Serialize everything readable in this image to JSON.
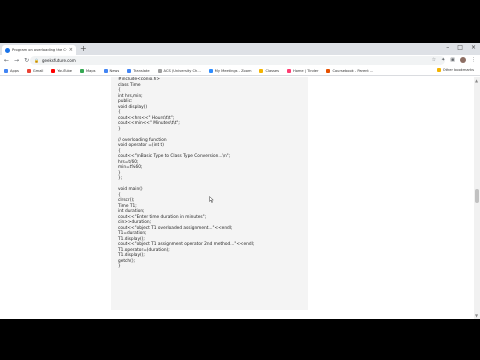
{
  "tab": {
    "title": "Program on overloading the C++",
    "close": "×",
    "new": "+"
  },
  "window": {
    "minimize": "–",
    "maximize": "□",
    "close": "×"
  },
  "toolbar": {
    "url": "geeksfuture.com",
    "back": "←",
    "forward": "→",
    "reload": "↻",
    "lock": "🔒"
  },
  "bookmarks": {
    "items": [
      {
        "label": "Apps",
        "color": "#4285f4"
      },
      {
        "label": "Gmail",
        "color": "#ea4335"
      },
      {
        "label": "YouTube",
        "color": "#ff0000"
      },
      {
        "label": "Maps",
        "color": "#34a853"
      },
      {
        "label": "News",
        "color": "#4285f4"
      },
      {
        "label": "Translate",
        "color": "#4285f4"
      },
      {
        "label": "ACS (University Ch...",
        "color": "#9e9e9e"
      },
      {
        "label": "My Meetings - Zoom",
        "color": "#2d8cff"
      },
      {
        "label": "Classes",
        "color": "#f4b400"
      },
      {
        "label": "Home | Tinder",
        "color": "#fe3c72"
      },
      {
        "label": "Coursebook - Parent ...",
        "color": "#e65100"
      }
    ],
    "other": "Other bookmarks"
  },
  "code": {
    "lines": [
      "#include<conio.h>",
      "class Time",
      "{",
      "int hrs,min;",
      "public:",
      "void display()",
      "{",
      "cout<<hrs<<\" Hours\\t\\t\";",
      "cout<<min<<\" Minutes\\t\\t\";",
      "}",
      "",
      "// overloading function",
      "void operator =(int t)",
      "{",
      "cout<<\"\\nBasic Type to Class Type Conversion...\\n\";",
      "hrs=t/60;",
      "min=t%60;",
      "}",
      "};",
      "",
      "void main()",
      "{",
      "clrscr();",
      "Time T1;",
      "int duration;",
      "cout<<\"Enter time duration in minutes\";",
      "cin>>duration;",
      "cout<<\"object T1 overloaded assignment...\"<<endl;",
      "T1=duration;",
      "T1.display();",
      "cout<<\"object T1 assignment operator 2nd method...\"<<endl;",
      "T1.operator=(duration);",
      "T1.display();",
      "getch();",
      "}"
    ]
  }
}
